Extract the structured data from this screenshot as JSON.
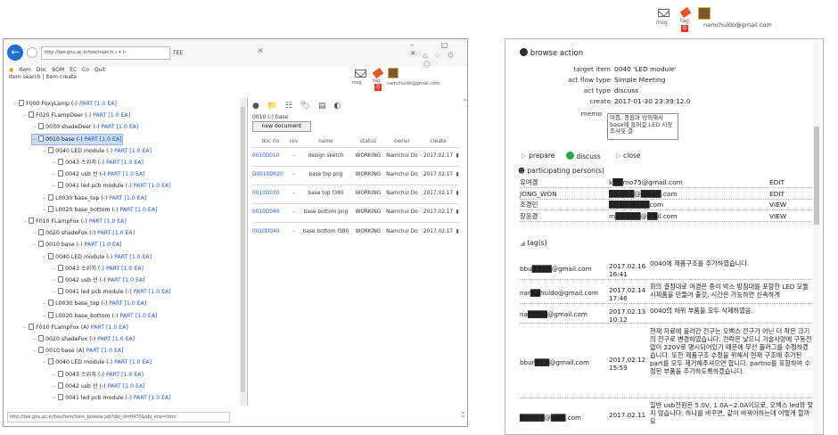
{
  "left_window": {
    "address": "http://tee.gnu.ac.kr/tee/main.h",
    "address_controls": "⌕ ▾ ↻",
    "tab_title": "TEE",
    "tab_close": "×",
    "window_controls": "– □ ×",
    "browser_icons": "⌂ ☆ ⚙ ☺",
    "menu": [
      "Item",
      "Doc",
      "BOM",
      "EC",
      "Co",
      "Quit"
    ],
    "menu2": [
      "Item search",
      "Item create"
    ],
    "user": {
      "msg": "msg",
      "tag": "tag",
      "badge": "0",
      "email": "namchuldo@gmail.com"
    },
    "tree": [
      {
        "label": "F000 FoxyLamp (-) ",
        "part": "PART [1.0 EA]",
        "level": 0,
        "sel": false
      },
      {
        "label": "F020 FLampDeer (-) ",
        "part": "PART [1.0 EA]",
        "level": 1,
        "sel": false
      },
      {
        "label": "0030 shadeDeer (-) ",
        "part": "PART [1.0 EA]",
        "level": 2,
        "sel": false
      },
      {
        "label": "0010 base (-) ",
        "part": "PART [1.0 EA]",
        "level": 2,
        "sel": true
      },
      {
        "label": "0040 LED module (-) ",
        "part": "PART [1.0 EA]",
        "level": 3,
        "sel": false
      },
      {
        "label": "0043 스위치 (-) ",
        "part": "PART [1.0 EA]",
        "level": 4,
        "sel": false
      },
      {
        "label": "0042 usb 선 (-) ",
        "part": "PART [1.0 EA]",
        "level": 4,
        "sel": false
      },
      {
        "label": "0041 led pcb module (-) ",
        "part": "PART [1.0 EA]",
        "level": 4,
        "sel": false
      },
      {
        "label": "L0030 base_top (-) ",
        "part": "PART [1.0 EA]",
        "level": 3,
        "sel": false
      },
      {
        "label": "L0020 base_bottom (-) ",
        "part": "PART [1.0 EA]",
        "level": 3,
        "sel": false
      },
      {
        "label": "F010 FLampFox (-) ",
        "part": "PART [1.0 EA]",
        "level": 1,
        "sel": false
      },
      {
        "label": "0020 shadeFox (-) ",
        "part": "PART [1.0 EA]",
        "level": 2,
        "sel": false
      },
      {
        "label": "0010 base (-) ",
        "part": "PART [1.0 EA]",
        "level": 2,
        "sel": false
      },
      {
        "label": "0040 LED module (-) ",
        "part": "PART [1.0 EA]",
        "level": 3,
        "sel": false
      },
      {
        "label": "0043 스위치 (-) ",
        "part": "PART [1.0 EA]",
        "level": 4,
        "sel": false
      },
      {
        "label": "0042 usb 선 (-) ",
        "part": "PART [1.0 EA]",
        "level": 4,
        "sel": false
      },
      {
        "label": "0041 led pcb module (-) ",
        "part": "PART [1.0 EA]",
        "level": 4,
        "sel": false
      },
      {
        "label": "L0030 base_top (-) ",
        "part": "PART [1.0 EA]",
        "level": 3,
        "sel": false
      },
      {
        "label": "L0020 base_bottom (-) ",
        "part": "PART [1.0 EA]",
        "level": 3,
        "sel": false
      },
      {
        "label": "F010 FLampFox (A) ",
        "part": "PART [1.0 EA]",
        "level": 1,
        "sel": false
      },
      {
        "label": "0020 shadeFox (-) ",
        "part": "PART [1.0 EA]",
        "level": 2,
        "sel": false
      },
      {
        "label": "0010 base (A) ",
        "part": "PART [1.0 EA]",
        "level": 2,
        "sel": false
      },
      {
        "label": "0040 LED module (-) ",
        "part": "PART [1.0 EA]",
        "level": 3,
        "sel": false
      },
      {
        "label": "0043 스위치 (-) ",
        "part": "PART [1.0 EA]",
        "level": 4,
        "sel": false
      },
      {
        "label": "0042 usb 선 (-) ",
        "part": "PART [1.0 EA]",
        "level": 4,
        "sel": false
      },
      {
        "label": "0041 led pcb module (-) ",
        "part": "PART [1.0 EA]",
        "level": 4,
        "sel": false
      }
    ],
    "doc_toolbar": "● 📁 ☷ 🏷 ▤ ◐",
    "crumb": "0010 (-) base",
    "new_document": "new document",
    "doc_headers": [
      "doc no",
      "rev",
      "name",
      "status",
      "owner",
      "create"
    ],
    "docs": [
      {
        "no": "0010D010",
        "rev": "-",
        "name": "design sketch",
        "status": "WORKING",
        "owner": "Namchul Do",
        "create": "2017.02.17"
      },
      {
        "no": "D0010D020",
        "rev": "-",
        "name": "base top png",
        "status": "WORKING",
        "owner": "Namchul Do",
        "create": "2017.02.17"
      },
      {
        "no": "0010D030",
        "rev": "-",
        "name": "base top f380",
        "status": "WORKING",
        "owner": "Namchul Do",
        "create": "2017.02.17"
      },
      {
        "no": "0010D040",
        "rev": "-",
        "name": "base bottom png",
        "status": "WORKING",
        "owner": "Namchul Do",
        "create": "2017.02.17"
      },
      {
        "no": "0010D040",
        "rev": "-",
        "name": "base bottom f380",
        "status": "WORKING",
        "owner": "Namchul Do",
        "create": "2017.02.17"
      }
    ],
    "statusbar": "http://tee.gnu.ac.kr/tee/item/item_browse.jsp?obj_id=8470&obj_env=item"
  },
  "right_header": {
    "msg": "msg",
    "tag": "tag",
    "badge": "0",
    "email": "namchuldo@gmail.com"
  },
  "browse_action": {
    "title": "browse action",
    "fields": [
      {
        "label": "target item",
        "value": "0040 'LED module'"
      },
      {
        "label": "act flow type",
        "value": "Simple Meeting"
      },
      {
        "label": "act type",
        "value": "discuss"
      },
      {
        "label": "create",
        "value": "2017-01-30 23:39:12.0"
      }
    ],
    "memo_label": "memo",
    "memo": "여종, 종원과 상의해서 base에 들어갈 LED 시장 조사및 결",
    "actions": {
      "prepare": "prepare",
      "discuss": "discuss",
      "close": "close"
    },
    "participants_title": "participating person(s)",
    "participants": [
      {
        "name": "유여경",
        "email": "k██mo75@gmail.com",
        "role": "EDIT"
      },
      {
        "name": "JONG_WON",
        "email": "█████@████.com",
        "role": "EDIT"
      },
      {
        "name": "조경민",
        "email": "████████com",
        "role": "VIEW"
      },
      {
        "name": "장윤경",
        "email": "m█████@██il.com",
        "role": "VIEW"
      }
    ],
    "tags_title": "tag(s)",
    "tags": [
      {
        "email": "bbu████@gmail.com",
        "date": "2017.02.16 16:41",
        "text": "0040에 제품구조를 추가하였습니다."
      },
      {
        "email": "nar██huldo@gmail.com",
        "date": "2017.02.14 17:46",
        "text": "회의 결정대로 여경은 종이 박스 방침대를 포함한 LED 모듈 시제품을 만들어 출것, 시간은 가능하면 신속하게"
      },
      {
        "email": "na████@gmail.com",
        "date": "2017.02.13 10:12",
        "text": "0040의 하위 부품을 모두 삭제하였음."
      },
      {
        "email": "bbur███@gmail.com",
        "date": "2017.02.12 15:59",
        "text": "현재 자료에 올라간 전구는 오백스 전구가 아닌 더 작은 크기의 전구로 변경하였습니다. 전력은 낮으니 기술사양에 구동전압이 220V로 명시되어있기 때문에 무선 플러그를 수정하겠습니다. 또한 제품구조 수정을 위해서 현재 구조에 추가된 part를 모두 제거해주셔으면 합니다. partno를 포함하여 수정된 부품을 추가하도록하겠습니다."
      },
      {
        "email": "█████@███.com",
        "date": "2017.02.11",
        "text": "일반 usb전원은 5.0V, 1.0A~2.0A이므로, 오백스 led와 맞지 않습니다. 하나를 바꾸면, 같이 바꿔야하는데 어떻게 할까요"
      }
    ]
  }
}
